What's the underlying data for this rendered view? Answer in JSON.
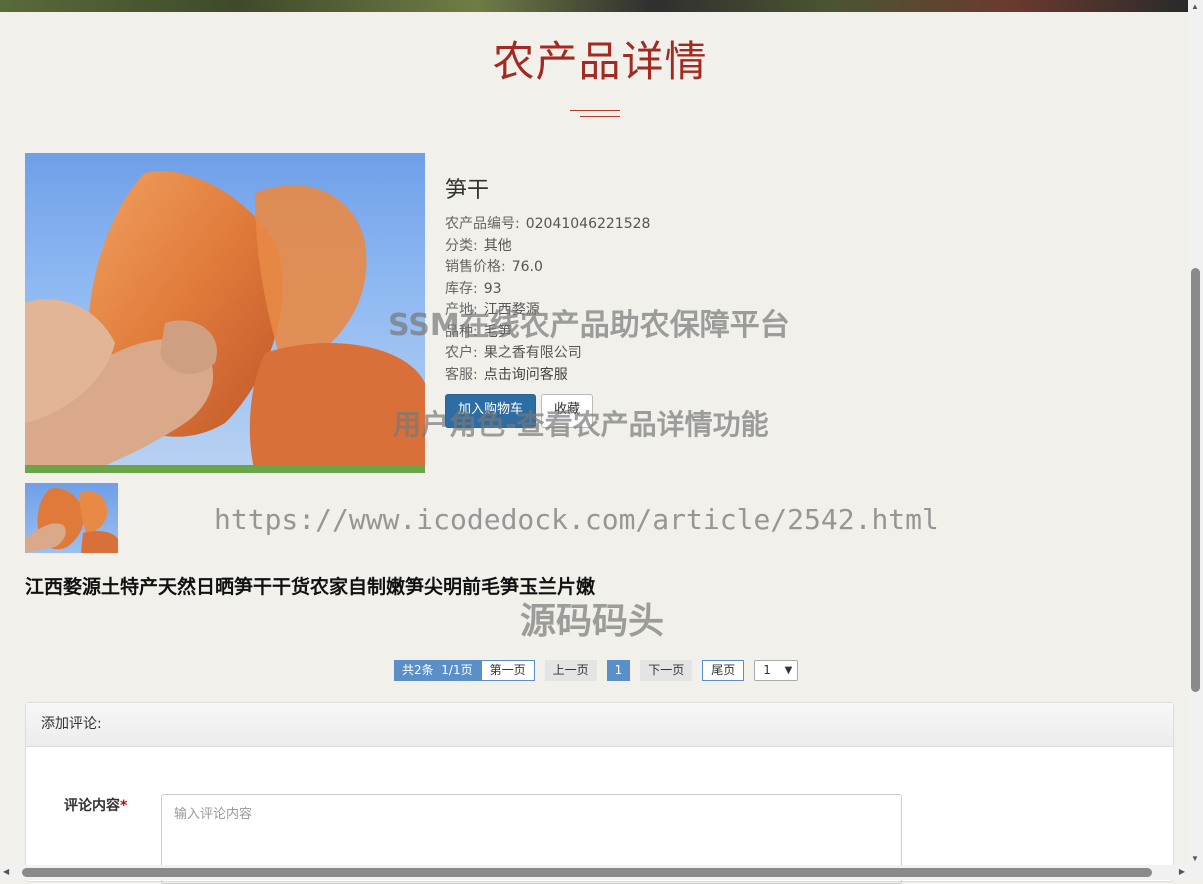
{
  "page": {
    "title": "农产品详情"
  },
  "product": {
    "name": "笋干",
    "code_label": "农产品编号:",
    "code": "02041046221528",
    "category_label": "分类:",
    "category": "其他",
    "price_label": "销售价格:",
    "price": "76.0",
    "stock_label": "库存:",
    "stock": "93",
    "origin_label": "产地:",
    "origin": "江西婺源",
    "variety_label": "品种:",
    "variety": "毛笋",
    "farmer_label": "农户:",
    "farmer": "果之香有限公司",
    "service_label": "客服:",
    "service": "点击询问客服",
    "add_cart": "加入购物车",
    "favorite": "收藏",
    "description": "江西婺源土特产天然日晒笋干干货农家自制嫩笋尖明前毛笋玉兰片嫩"
  },
  "pagination": {
    "info": "共2条  1/1页",
    "first": "第一页",
    "prev": "上一页",
    "current": "1",
    "next": "下一页",
    "last": "尾页",
    "select_value": "1"
  },
  "comment": {
    "header": "添加评论:",
    "label": "评论内容",
    "required_mark": "*",
    "placeholder": "输入评论内容"
  },
  "watermarks": {
    "line1": "SSM在线农产品助农保障平台",
    "line2": "用户角色-查看农产品详情功能",
    "line3": "https://www.icodedock.com/article/2542.html",
    "line4": "源码码头"
  },
  "icons": {
    "scroll_up": "triangle-up",
    "scroll_down": "triangle-down",
    "scroll_left": "triangle-left",
    "scroll_right": "triangle-right",
    "select_chevron": "chevron-down"
  }
}
